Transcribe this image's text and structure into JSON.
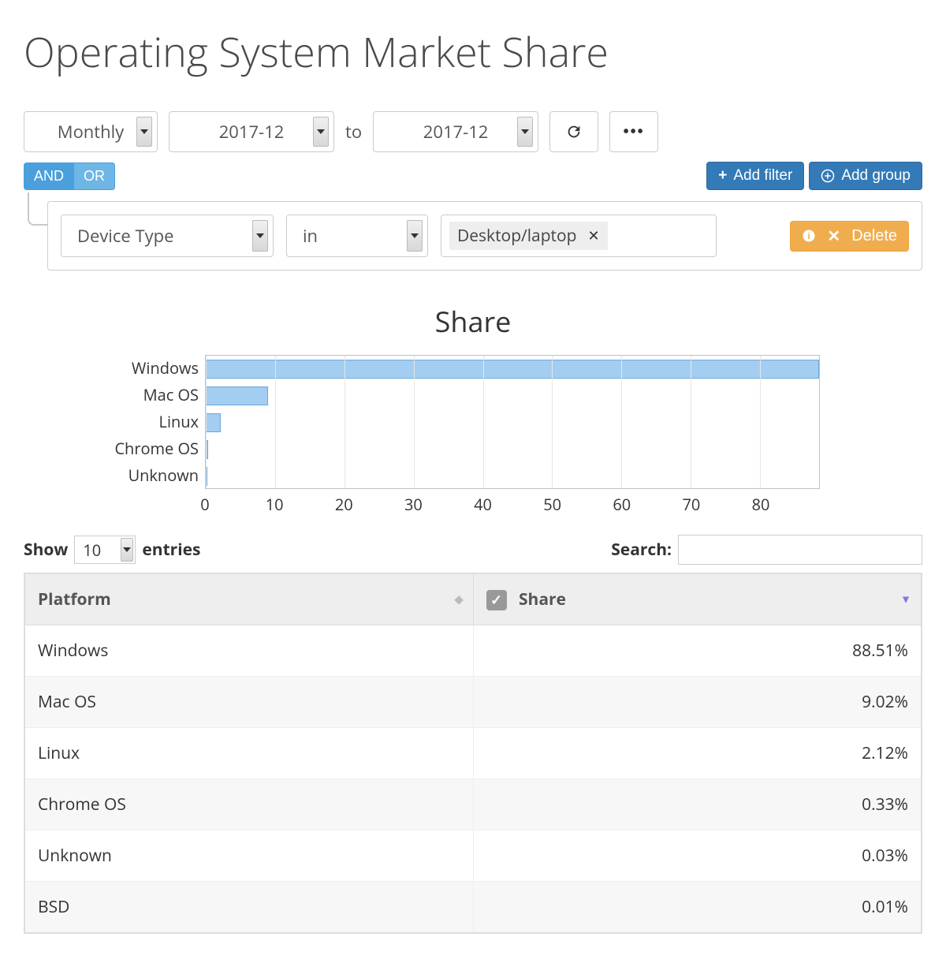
{
  "page_title": "Operating System Market Share",
  "controls": {
    "period": "Monthly",
    "from": "2017-12",
    "to_label": "to",
    "to": "2017-12"
  },
  "logic": {
    "and": "AND",
    "or": "OR"
  },
  "buttons": {
    "add_filter": "Add filter",
    "add_group": "Add group",
    "delete": "Delete"
  },
  "filter": {
    "field": "Device Type",
    "op": "in",
    "value": "Desktop/laptop"
  },
  "chart_data": {
    "type": "bar",
    "title": "Share",
    "orientation": "horizontal",
    "categories": [
      "Windows",
      "Mac OS",
      "Linux",
      "Chrome OS",
      "Unknown"
    ],
    "values": [
      88.51,
      9.02,
      2.12,
      0.33,
      0.03
    ],
    "xlim": [
      0,
      88.51
    ],
    "xticks": [
      0,
      10,
      20,
      30,
      40,
      50,
      60,
      70,
      80
    ],
    "xlabel": "",
    "ylabel": ""
  },
  "table": {
    "show_label": "Show",
    "entries_value": "10",
    "entries_label": "entries",
    "search_label": "Search:",
    "columns": {
      "platform": "Platform",
      "share": "Share"
    },
    "rows": [
      {
        "platform": "Windows",
        "share": "88.51%"
      },
      {
        "platform": "Mac OS",
        "share": "9.02%"
      },
      {
        "platform": "Linux",
        "share": "2.12%"
      },
      {
        "platform": "Chrome OS",
        "share": "0.33%"
      },
      {
        "platform": "Unknown",
        "share": "0.03%"
      },
      {
        "platform": "BSD",
        "share": "0.01%"
      }
    ]
  }
}
